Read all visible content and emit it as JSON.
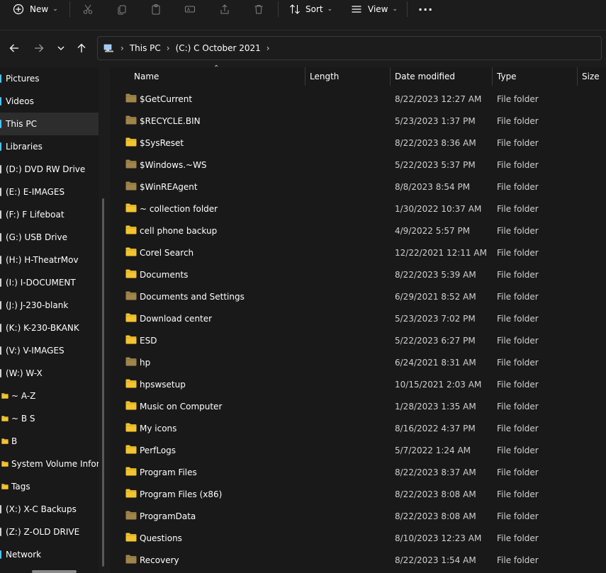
{
  "toolbar": {
    "new_label": "New",
    "sort_label": "Sort",
    "view_label": "View",
    "more_label": "···"
  },
  "address": {
    "crumbs": [
      "This PC",
      "(C:) C October 2021"
    ]
  },
  "sidebar": {
    "items": [
      {
        "label": "Pictures",
        "kind": "lib"
      },
      {
        "label": "Videos",
        "kind": "lib"
      },
      {
        "label": "This PC",
        "kind": "pc",
        "selected": true
      },
      {
        "label": "Libraries",
        "kind": "lib"
      },
      {
        "label": "(D:) DVD RW Drive",
        "kind": "drive"
      },
      {
        "label": "(E:) E-IMAGES",
        "kind": "drive"
      },
      {
        "label": "(F:) F Lifeboat",
        "kind": "drive"
      },
      {
        "label": "(G:) USB Drive",
        "kind": "drive"
      },
      {
        "label": "(H:) H-TheatrMov",
        "kind": "drive"
      },
      {
        "label": "(I:) I-DOCUMENT",
        "kind": "drive"
      },
      {
        "label": "(J:) J-230-blank",
        "kind": "drive"
      },
      {
        "label": "(K:) K-230-BKANK",
        "kind": "drive"
      },
      {
        "label": "(V:) V-IMAGES",
        "kind": "drive"
      },
      {
        "label": "(W:) W-X",
        "kind": "drive"
      },
      {
        "label": "~ A-Z",
        "kind": "folder"
      },
      {
        "label": "~ B S",
        "kind": "folder"
      },
      {
        "label": "B",
        "kind": "folder"
      },
      {
        "label": "System Volume Inform",
        "kind": "folder"
      },
      {
        "label": "Tags",
        "kind": "folder"
      },
      {
        "label": "(X:) X-C Backups",
        "kind": "drive"
      },
      {
        "label": "(Z:) Z-OLD DRIVE",
        "kind": "drive"
      },
      {
        "label": "Network",
        "kind": "net"
      }
    ]
  },
  "columns": {
    "name": "Name",
    "length": "Length",
    "date_modified": "Date modified",
    "type": "Type",
    "size": "Size"
  },
  "files": [
    {
      "name": "$GetCurrent",
      "date": "8/22/2023 12:27 AM",
      "type": "File folder",
      "hidden": true
    },
    {
      "name": "$RECYCLE.BIN",
      "date": "5/23/2023 1:37 PM",
      "type": "File folder",
      "hidden": true
    },
    {
      "name": "$SysReset",
      "date": "8/22/2023 8:36 AM",
      "type": "File folder",
      "hidden": false
    },
    {
      "name": "$Windows.~WS",
      "date": "5/22/2023 5:37 PM",
      "type": "File folder",
      "hidden": true
    },
    {
      "name": "$WinREAgent",
      "date": "8/8/2023 8:54 PM",
      "type": "File folder",
      "hidden": true
    },
    {
      "name": "~ collection folder",
      "date": "1/30/2022 10:37 AM",
      "type": "File folder",
      "hidden": false
    },
    {
      "name": "cell phone backup",
      "date": "4/9/2022 5:57 PM",
      "type": "File folder",
      "hidden": false
    },
    {
      "name": "Corel Search",
      "date": "12/22/2021 12:11 AM",
      "type": "File folder",
      "hidden": false
    },
    {
      "name": "Documents",
      "date": "8/22/2023 5:39 AM",
      "type": "File folder",
      "hidden": false
    },
    {
      "name": "Documents and Settings",
      "date": "6/29/2021 8:52 AM",
      "type": "File folder",
      "hidden": true
    },
    {
      "name": "Download center",
      "date": "5/23/2023 7:02 PM",
      "type": "File folder",
      "hidden": false
    },
    {
      "name": "ESD",
      "date": "5/22/2023 6:27 PM",
      "type": "File folder",
      "hidden": false
    },
    {
      "name": "hp",
      "date": "6/24/2021 8:31 AM",
      "type": "File folder",
      "hidden": true
    },
    {
      "name": "hpswsetup",
      "date": "10/15/2021 2:03 AM",
      "type": "File folder",
      "hidden": false
    },
    {
      "name": "Music on Computer",
      "date": "1/28/2023 1:35 AM",
      "type": "File folder",
      "hidden": false
    },
    {
      "name": "My icons",
      "date": "8/16/2022 4:37 PM",
      "type": "File folder",
      "hidden": false
    },
    {
      "name": "PerfLogs",
      "date": "5/7/2022 1:24 AM",
      "type": "File folder",
      "hidden": false
    },
    {
      "name": "Program Files",
      "date": "8/22/2023 8:37 AM",
      "type": "File folder",
      "hidden": false
    },
    {
      "name": "Program Files (x86)",
      "date": "8/22/2023 8:08 AM",
      "type": "File folder",
      "hidden": false
    },
    {
      "name": "ProgramData",
      "date": "8/22/2023 8:08 AM",
      "type": "File folder",
      "hidden": true
    },
    {
      "name": "Questions",
      "date": "8/10/2023 12:23 AM",
      "type": "File folder",
      "hidden": false
    },
    {
      "name": "Recovery",
      "date": "8/22/2023 1:54 AM",
      "type": "File folder",
      "hidden": true
    }
  ],
  "colors": {
    "folder": "#f4c430",
    "folder_hidden": "#a0854a",
    "accent": "#4cc2ff"
  }
}
